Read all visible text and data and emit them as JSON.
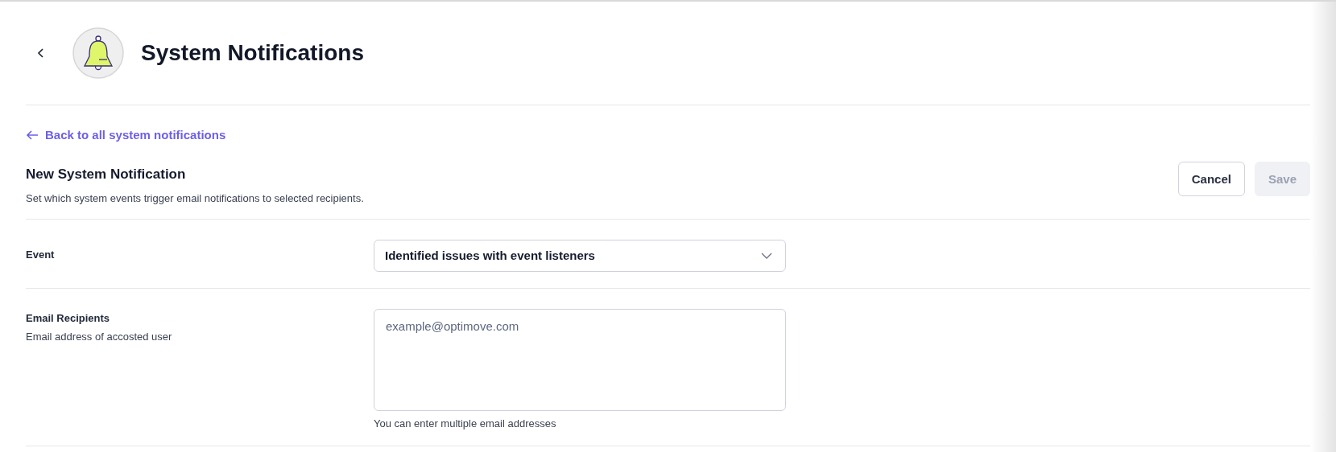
{
  "header": {
    "title": "System Notifications"
  },
  "back_link": "Back to all system notifications",
  "form": {
    "title": "New System Notification",
    "subtitle": "Set which system events trigger email notifications to selected recipients.",
    "buttons": [
      {
        "label": "Cancel",
        "disabled": false
      },
      {
        "label": "Save",
        "disabled": true
      }
    ],
    "fields": [
      {
        "kind": "select",
        "label": "Event",
        "value": "Identified issues with event listeners"
      },
      {
        "kind": "textarea",
        "label": "Email Recipients",
        "description": "Email address of accosted user",
        "placeholder": "example@optimove.com",
        "help": "You can enter multiple email addresses"
      }
    ]
  }
}
